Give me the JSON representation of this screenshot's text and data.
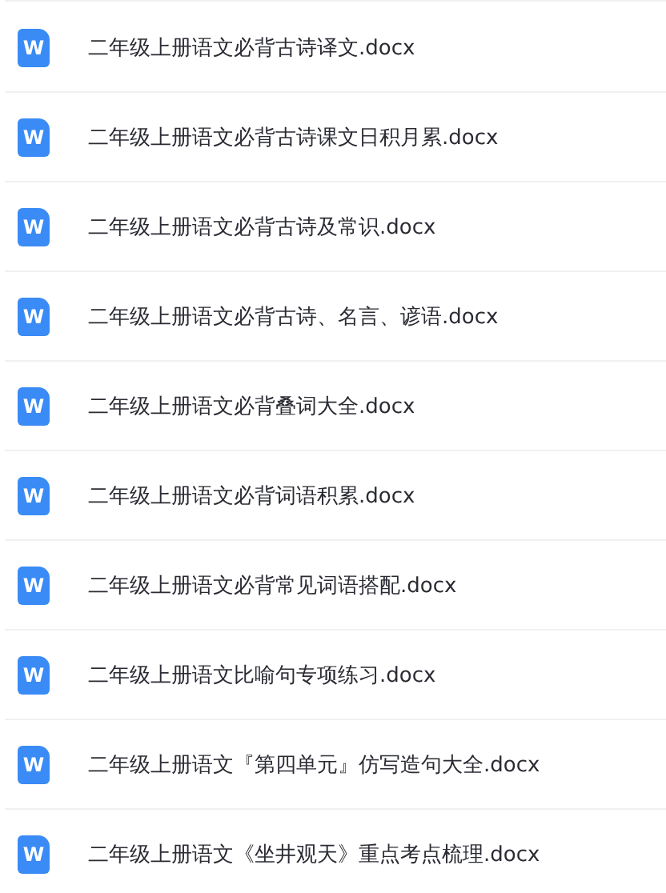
{
  "files": [
    {
      "icon_letter": "W",
      "name": "二年级上册语文必背古诗译文.docx"
    },
    {
      "icon_letter": "W",
      "name": "二年级上册语文必背古诗课文日积月累.docx"
    },
    {
      "icon_letter": "W",
      "name": "二年级上册语文必背古诗及常识.docx"
    },
    {
      "icon_letter": "W",
      "name": "二年级上册语文必背古诗、名言、谚语.docx"
    },
    {
      "icon_letter": "W",
      "name": "二年级上册语文必背叠词大全.docx"
    },
    {
      "icon_letter": "W",
      "name": "二年级上册语文必背词语积累.docx"
    },
    {
      "icon_letter": "W",
      "name": "二年级上册语文必背常见词语搭配.docx"
    },
    {
      "icon_letter": "W",
      "name": "二年级上册语文比喻句专项练习.docx"
    },
    {
      "icon_letter": "W",
      "name": "二年级上册语文『第四单元』仿写造句大全.docx"
    },
    {
      "icon_letter": "W",
      "name": "二年级上册语文《坐井观天》重点考点梳理.docx"
    }
  ]
}
